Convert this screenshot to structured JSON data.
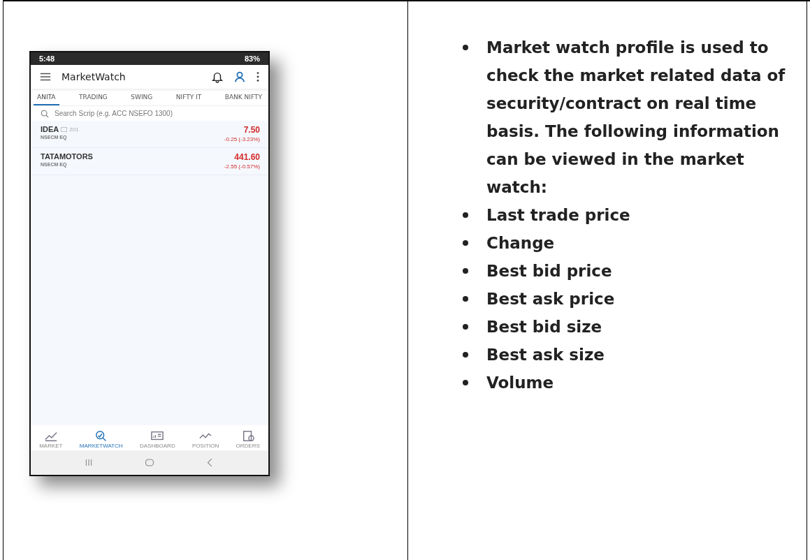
{
  "phone": {
    "status_bar": {
      "time": "5:48",
      "battery": "83%"
    },
    "app_bar": {
      "title": "MarketWatch"
    },
    "tabs": [
      {
        "label": "ANITA",
        "selected": true
      },
      {
        "label": "TRADING",
        "selected": false
      },
      {
        "label": "SWING",
        "selected": false
      },
      {
        "label": "NIFTY IT",
        "selected": false
      },
      {
        "label": "BANK NIFTY",
        "selected": false
      }
    ],
    "search": {
      "placeholder": "Search Scrip (e.g. ACC NSEFO 1300)"
    },
    "rows": [
      {
        "symbol": "IDEA",
        "badge": "201",
        "exchange": "NSECM EQ",
        "price": "7.50",
        "change": "-0.25 (-3.23%)"
      },
      {
        "symbol": "TATAMOTORS",
        "exchange": "NSECM EQ",
        "price": "441.60",
        "change": "-2.55 (-0.57%)"
      }
    ],
    "bottom_nav": [
      {
        "kind": "market",
        "label": "MARKET",
        "selected": false
      },
      {
        "kind": "watch",
        "label": "MARKETWATCH",
        "selected": true
      },
      {
        "kind": "dashboard",
        "label": "DASHBOARD",
        "selected": false
      },
      {
        "kind": "position",
        "label": "POSITION",
        "selected": false
      },
      {
        "kind": "orders",
        "label": "ORDERS",
        "selected": false
      }
    ]
  },
  "description": {
    "bullets": [
      "Market watch profile is used to check the market related data of security/contract on real time basis. The following information can be viewed in the market watch:",
      "Last trade price",
      "Change",
      "Best bid price",
      "Best ask price",
      "Best bid size",
      "Best ask size",
      "Volume"
    ]
  }
}
